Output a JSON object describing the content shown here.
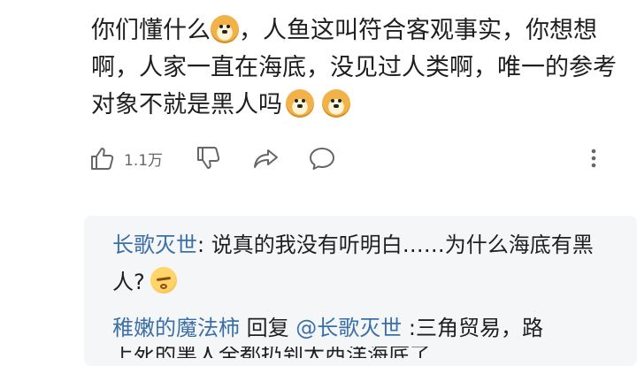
{
  "comment": {
    "part1": "你们懂什么",
    "part2": "，人鱼这叫符合客观事实，你想想啊，人家一直在海底，没见过人类啊，唯一的参考对象不就是黑人吗",
    "emoji_icon": "doge-emoji"
  },
  "actions": {
    "like_count": "1.1万",
    "icons": [
      "thumbs-up-icon",
      "thumbs-down-icon",
      "share-icon",
      "comment-icon",
      "more-vertical-icon"
    ]
  },
  "replies": [
    {
      "user": "长歌灭世",
      "text": ": 说真的我没有听明白……为什么海底有黑人?",
      "emoji_icon": "pout-emoji"
    },
    {
      "user": "稚嫩的魔法柿",
      "reply_word": " 回复 ",
      "mention": "@长歌灭世",
      "text": " :三角贸易，路",
      "next_line_partial": "上死的黑人全都扔到大西洋海底了"
    }
  ],
  "colors": {
    "username": "#3b6fa8",
    "reply_bg": "#f5f6f7",
    "icon": "#666666"
  }
}
